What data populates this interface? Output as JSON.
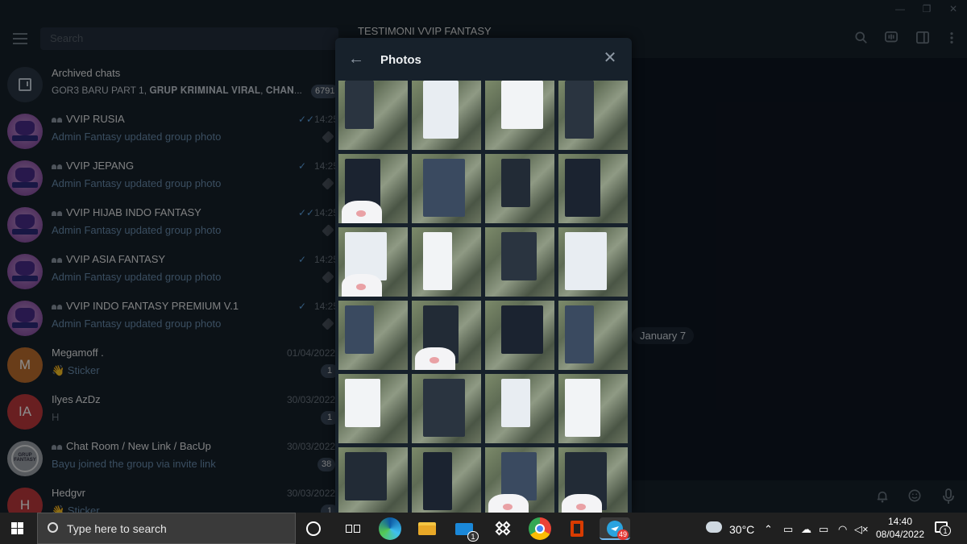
{
  "window": {
    "app": "Telegram Desktop"
  },
  "sidebar": {
    "search_placeholder": "Search",
    "archived": {
      "title": "Archived chats",
      "preview": "GOR3 BARU PART 1, 𝐆𝐑𝐔𝐏 𝐊𝐑𝐈𝐌𝐈𝐍𝐀𝐋 𝐕𝐈𝐑𝐀𝐋, 𝐂𝐇𝐀𝐍...",
      "count": "6791"
    },
    "chats": [
      {
        "title": "VVIP RUSIA",
        "group": true,
        "message": "Admin Fantasy updated group photo",
        "time": "14:25",
        "ticks": "✓✓",
        "pinned": true,
        "avatar": "fantasy"
      },
      {
        "title": "VVIP JEPANG",
        "group": true,
        "message": "Admin Fantasy updated group photo",
        "time": "14:25",
        "ticks": "✓",
        "pinned": true,
        "avatar": "fantasy"
      },
      {
        "title": "VVIP HIJAB INDO FANTASY",
        "group": true,
        "message": "Admin Fantasy updated group photo",
        "time": "14:25",
        "ticks": "✓✓",
        "pinned": true,
        "avatar": "fantasy"
      },
      {
        "title": "VVIP ASIA FANTASY",
        "group": true,
        "message": "Admin Fantasy updated group photo",
        "time": "14:25",
        "ticks": "✓",
        "pinned": true,
        "avatar": "fantasy"
      },
      {
        "title": "VVIP INDO FANTASY PREMIUM V.1",
        "group": true,
        "message": "Admin Fantasy updated group photo",
        "time": "14:25",
        "ticks": "✓",
        "pinned": true,
        "avatar": "fantasy"
      },
      {
        "title": "Megamoff .",
        "group": false,
        "message": "👋 Sticker",
        "time": "01/04/2022",
        "badge": "1",
        "avatar": "M",
        "avatar_color": "#c0702f"
      },
      {
        "title": "Ilyes AzDz",
        "group": false,
        "message": "H",
        "time": "30/03/2022",
        "badge": "1",
        "avatar": "IA",
        "avatar_color": "#c0393d",
        "gray": true
      },
      {
        "title": "Chat Room / New Link / BacUp",
        "group": true,
        "message": "Bayu joined the group via invite link",
        "time": "30/03/2022",
        "badge": "38",
        "avatar": "grup",
        "avatar_text": "GRUP FANTASY"
      },
      {
        "title": "Hedgvr",
        "group": false,
        "message": "👋 Sticker",
        "time": "30/03/2022",
        "badge": "1",
        "avatar": "H",
        "avatar_color": "#c0393d"
      }
    ]
  },
  "main": {
    "chat_title": "TESTIMONI VVIP FANTASY",
    "date_label": "January 7"
  },
  "photos": {
    "title": "Photos",
    "rows": 6,
    "cols": 4
  },
  "taskbar": {
    "search_placeholder": "Type here to search",
    "mail_badge": "1",
    "telegram_badge": "49",
    "weather": "30°C",
    "time": "14:40",
    "date": "08/04/2022",
    "notifications": "1"
  },
  "colors": {
    "sidebar_bg": "#17212b",
    "chat_bg": "#0e1621",
    "accent_link": "#6a8eb0",
    "tick_blue": "#5ea4e3"
  }
}
